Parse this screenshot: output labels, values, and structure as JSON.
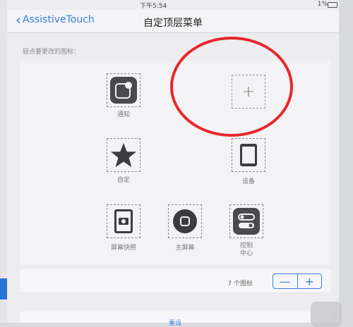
{
  "status": {
    "time": "下午5:54",
    "battery": "1%"
  },
  "nav": {
    "back_label": "AssistiveTouch",
    "title": "自定顶层菜单"
  },
  "hint": "轻点要更改的图标：",
  "icons": [
    {
      "label": "通知"
    },
    {
      "label": "自定"
    },
    {
      "label": "设备"
    },
    {
      "label": "屏幕快照"
    },
    {
      "label": "主屏幕"
    },
    {
      "label": "控制\n中心"
    }
  ],
  "footer": {
    "count": "7 个图标",
    "minus": "—",
    "plus": "+"
  },
  "reset": "重设",
  "colors": {
    "accent": "#3a7ee0",
    "highlight": "#e8272b",
    "tile": "#4a4a4e"
  }
}
